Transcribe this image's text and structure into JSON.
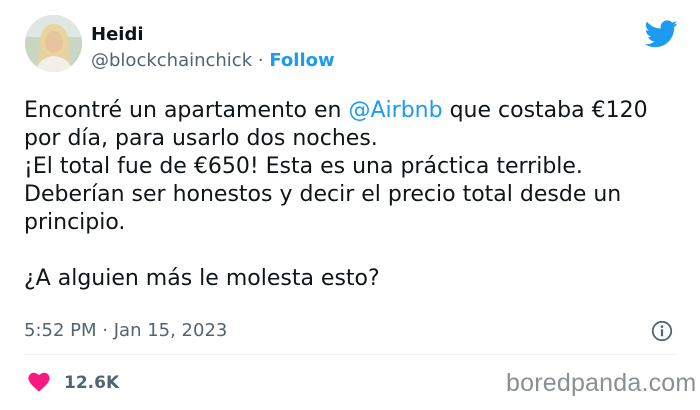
{
  "author": {
    "name": "Heidi",
    "handle": "@blockchainchick",
    "separator": "·",
    "follow_label": "Follow"
  },
  "tweet": {
    "lines": [
      {
        "before": "Encontré un apartamento en ",
        "mention": "@Airbnb",
        "after": " que costaba €120"
      },
      {
        "text": "por día, para usarlo dos noches."
      },
      {
        "text": "¡El total fue de €650! Esta es una práctica terrible."
      },
      {
        "text": "Deberían ser honestos y decir el precio total desde un"
      },
      {
        "text": "principio."
      },
      {
        "text": ""
      },
      {
        "text": "¿A alguien más le molesta esto?"
      }
    ]
  },
  "meta": {
    "time": "5:52 PM",
    "separator": "·",
    "date": "Jan 15, 2023"
  },
  "engagement": {
    "likes": "12.6K"
  },
  "watermark": "boredpanda.com",
  "colors": {
    "twitter_blue": "#1d9bf0",
    "heart_red": "#f91880",
    "secondary_text": "#536471",
    "primary_text": "#0f1419"
  },
  "icons": {
    "brand": "twitter-bird-icon",
    "info": "info-icon",
    "like": "heart-icon"
  }
}
